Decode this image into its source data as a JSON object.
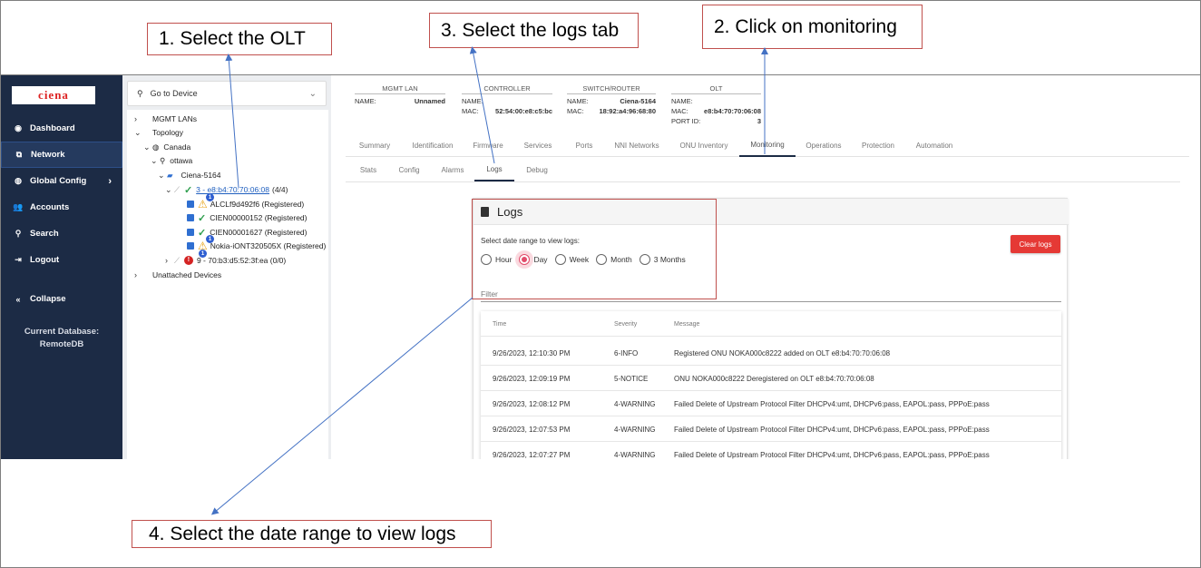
{
  "callouts": {
    "c1": "1. Select the OLT",
    "c2": "2. Click on monitoring",
    "c3": "3. Select the logs tab",
    "c4": "4. Select the date range to view logs"
  },
  "sidebar": {
    "logo": "ciena",
    "items": [
      {
        "label": "Dashboard",
        "icon": "gauge-icon"
      },
      {
        "label": "Network",
        "icon": "network-icon"
      },
      {
        "label": "Global Config",
        "icon": "globe-icon"
      },
      {
        "label": "Accounts",
        "icon": "users-icon"
      },
      {
        "label": "Search",
        "icon": "search-icon"
      },
      {
        "label": "Logout",
        "icon": "logout-icon"
      }
    ],
    "collapse": "Collapse",
    "db_line1": "Current Database:",
    "db_line2": "RemoteDB"
  },
  "tree": {
    "goto": "Go to Device",
    "mgmt": "MGMT LANs",
    "topology": "Topology",
    "canada": "Canada",
    "ottawa": "ottawa",
    "switch": "Ciena-5164",
    "olt_link": "3 -  e8:b4:70:70:06:08",
    "olt_count": "(4/4)",
    "onu1": "ALCLf9d492f6 (Registered)",
    "onu2": "CIEN00000152 (Registered)",
    "onu3": "CIEN00001627 (Registered)",
    "onu4": "Nokia-iONT320505X (Registered)",
    "olt2": "9 -  70:b3:d5:52:3f:ea (0/0)",
    "unattached": "Unattached Devices"
  },
  "devices": {
    "mgmt": {
      "title": "MGMT LAN",
      "name_label": "NAME:",
      "name": "Unnamed"
    },
    "controller": {
      "title": "CONTROLLER",
      "name_label": "NAME:",
      "mac_label": "MAC:",
      "mac": "52:54:00:e8:c5:bc"
    },
    "switch": {
      "title": "SWITCH/ROUTER",
      "name_label": "NAME:",
      "name": "Ciena-5164",
      "mac_label": "MAC:",
      "mac": "18:92:a4:96:68:80"
    },
    "olt": {
      "title": "OLT",
      "name_label": "NAME:",
      "mac_label": "MAC:",
      "mac": "e8:b4:70:70:06:08",
      "port_label": "PORT ID:",
      "port": "3"
    }
  },
  "tabs": [
    "Summary",
    "Identification",
    "Firmware",
    "Services",
    "Ports",
    "NNI Networks",
    "ONU Inventory",
    "Monitoring",
    "Operations",
    "Protection",
    "Automation"
  ],
  "subtabs": [
    "Stats",
    "Config",
    "Alarms",
    "Logs",
    "Debug"
  ],
  "logs": {
    "title": "Logs",
    "range_label": "Select date range to view logs:",
    "ranges": [
      "Hour",
      "Day",
      "Week",
      "Month",
      "3 Months"
    ],
    "selected_range": "Day",
    "clear": "Clear logs",
    "filter": "Filter",
    "columns": [
      "Time",
      "Severity",
      "Message"
    ],
    "rows": [
      [
        "9/26/2023, 12:10:30 PM",
        "6-INFO",
        "Registered ONU NOKA000c8222 added on OLT e8:b4:70:70:06:08"
      ],
      [
        "9/26/2023, 12:09:19 PM",
        "5-NOTICE",
        "ONU NOKA000c8222 Deregistered on OLT e8:b4:70:70:06:08"
      ],
      [
        "9/26/2023, 12:08:12 PM",
        "4-WARNING",
        "Failed Delete of Upstream Protocol Filter DHCPv4:umt, DHCPv6:pass, EAPOL:pass, PPPoE:pass"
      ],
      [
        "9/26/2023, 12:07:53 PM",
        "4-WARNING",
        "Failed Delete of Upstream Protocol Filter DHCPv4:umt, DHCPv6:pass, EAPOL:pass, PPPoE:pass"
      ],
      [
        "9/26/2023, 12:07:27 PM",
        "4-WARNING",
        "Failed Delete of Upstream Protocol Filter DHCPv4:umt, DHCPv6:pass, EAPOL:pass, PPPoE:pass"
      ]
    ]
  },
  "colors": {
    "sidebar_bg": "#1c2b45",
    "accent_red": "#e53935",
    "callout_border": "#c0504d",
    "link": "#1f5fbf"
  }
}
